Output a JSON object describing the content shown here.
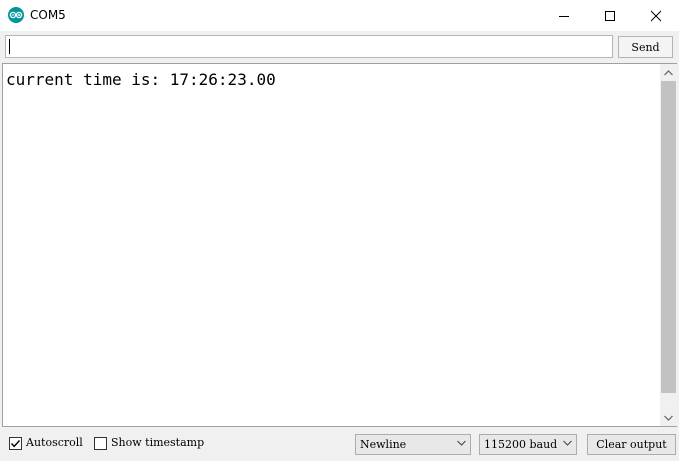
{
  "window": {
    "title": "COM5",
    "icon": "arduino-logo-icon",
    "accent_color": "#00979c"
  },
  "send_bar": {
    "input_value": "",
    "send_label": "Send"
  },
  "output": {
    "lines": [
      "current time is: 17:26:23.00"
    ]
  },
  "bottom_bar": {
    "autoscroll": {
      "label": "Autoscroll",
      "checked": true
    },
    "show_timestamp": {
      "label": "Show timestamp",
      "checked": false
    },
    "line_ending": {
      "selected": "Newline"
    },
    "baud_rate": {
      "selected": "115200 baud"
    },
    "clear_label": "Clear output"
  }
}
